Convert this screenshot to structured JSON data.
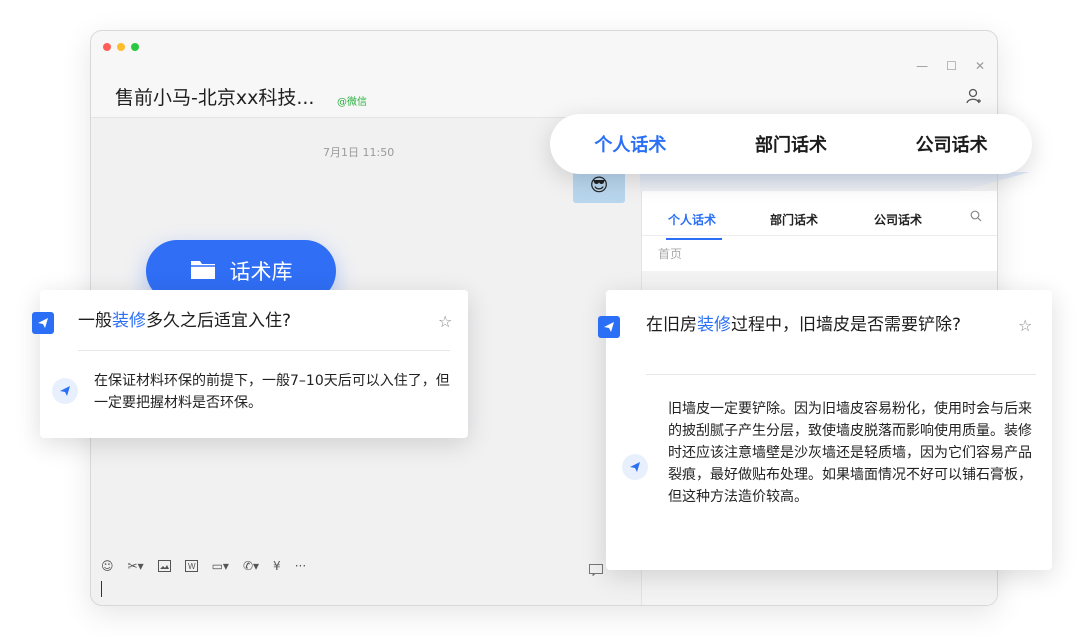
{
  "window": {
    "title": "售前小马-北京xx科技...",
    "tag": "@微信",
    "time": "7月1日 11:50",
    "emoji": "😎"
  },
  "side_panel": {
    "tabs": [
      "个人话术",
      "部门话术",
      "公司话术"
    ],
    "home": "首页"
  },
  "top_tabs": [
    "个人话术",
    "部门话术",
    "公司话术"
  ],
  "library": {
    "label": "话术库"
  },
  "card_left": {
    "question_pre": "一般",
    "question_hl": "装修",
    "question_post": "多久之后适宜入住?",
    "answer": "在保证材料环保的前提下，一般7–10天后可以入住了，但一定要把握材料是否环保。"
  },
  "card_right": {
    "question_pre": "在旧房",
    "question_hl": "装修",
    "question_post": "过程中，旧墙皮是否需要铲除?",
    "answer": "旧墙皮一定要铲除。因为旧墙皮容易粉化，使用时会与后来的披刮腻子产生分层，致使墙皮脱落而影响使用质量。装修时还应该注意墙壁是沙灰墙还是轻质墙，因为它们容易产品裂痕，最好做贴布处理。如果墙面情况不好可以铺石膏板，但这种方法造价较高。"
  },
  "colors": {
    "accent": "#2a6ff5",
    "tag": "#28b03c"
  },
  "icons": [
    "traffic-lights",
    "minimize-icon",
    "maximize-icon",
    "close-icon",
    "add-user-icon",
    "search-icon",
    "folder-icon",
    "paper-plane-icon",
    "star-icon",
    "emoji-icon",
    "scissors-icon",
    "image-icon",
    "word-icon",
    "folder-small-icon",
    "phone-icon",
    "money-icon",
    "more-icon"
  ]
}
